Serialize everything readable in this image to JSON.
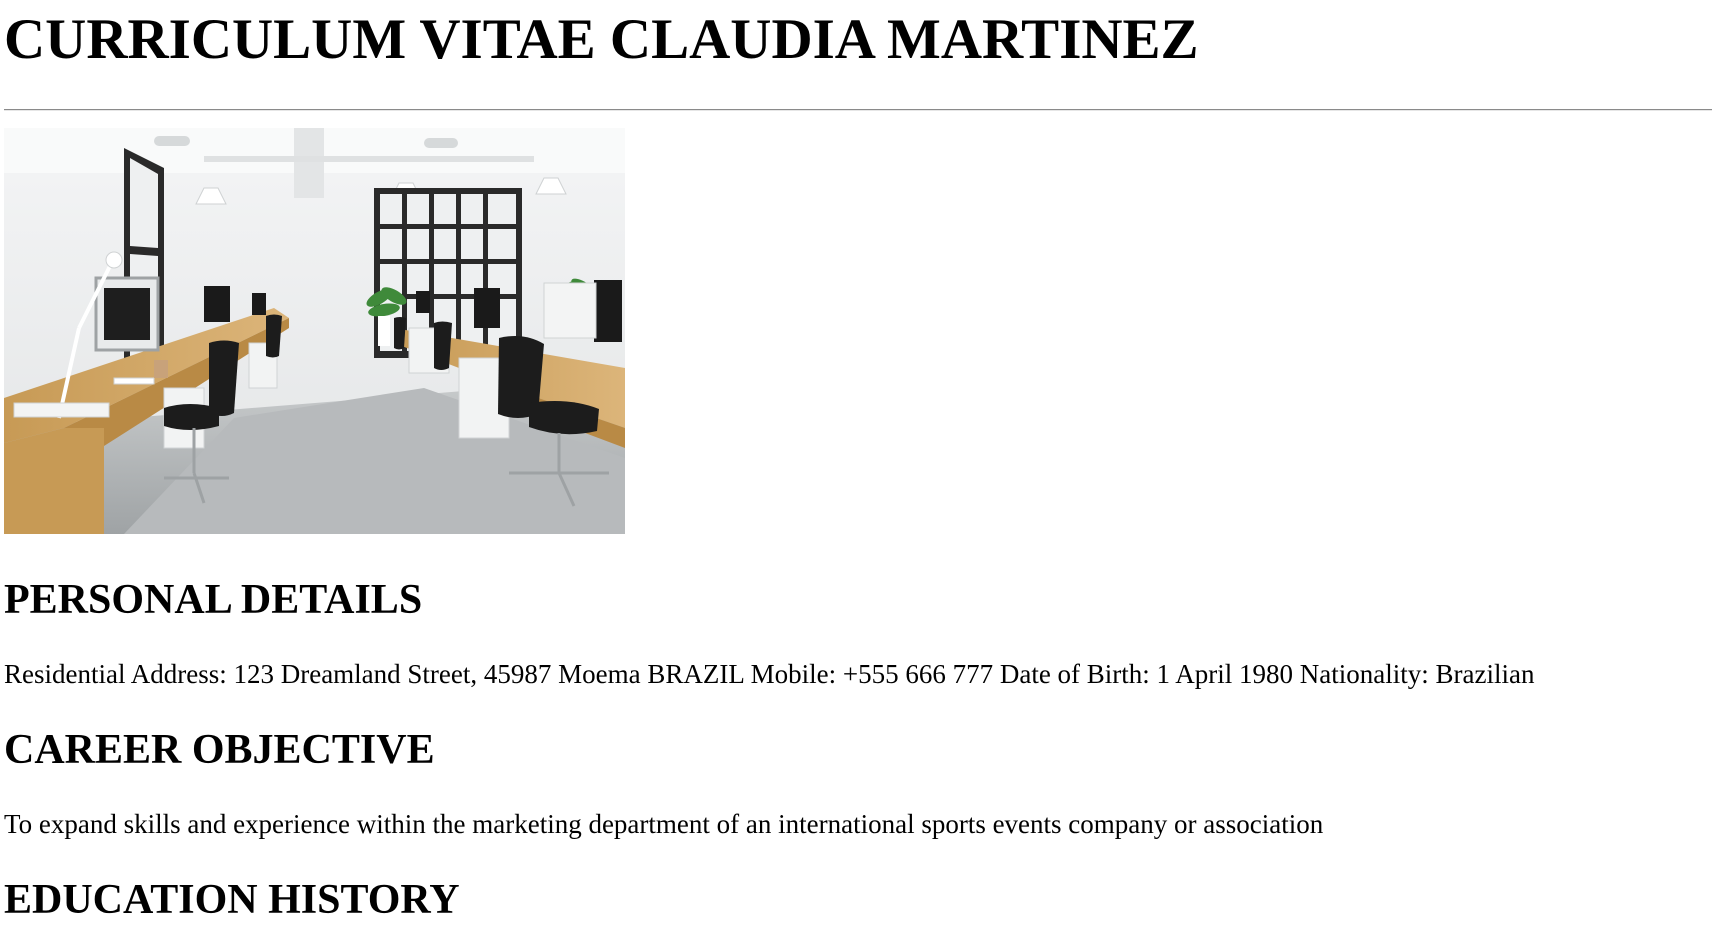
{
  "document": {
    "title": "CURRICULUM VITAE CLAUDIA MARTINEZ",
    "image_subject": "office-interior-photo"
  },
  "sections": {
    "personal": {
      "heading": "PERSONAL DETAILS",
      "text": "Residential Address: 123 Dreamland Street, 45987 Moema BRAZIL Mobile: +555 666 777 Date of Birth: 1 April 1980 Nationality: Brazilian"
    },
    "career": {
      "heading": "CAREER OBJECTIVE",
      "text": "To expand skills and experience within the marketing department of an international sports events company or association"
    },
    "education": {
      "heading": "EDUCATION HISTORY"
    }
  }
}
